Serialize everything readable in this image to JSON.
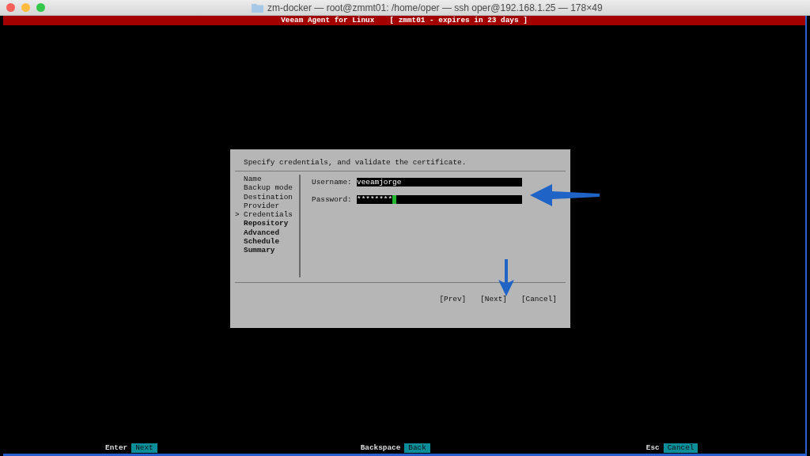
{
  "window": {
    "title": "zm-docker — root@zmmt01: /home/oper — ssh oper@192.168.1.25 — 178×49"
  },
  "header": {
    "app": "Veeam Agent for Linux",
    "info": "[ zmmt01 - expires in 23 days ]"
  },
  "dialog": {
    "prompt": "Specify credentials, and validate the certificate.",
    "steps": [
      {
        "label": "Name",
        "selected": false,
        "pending": false
      },
      {
        "label": "Backup mode",
        "selected": false,
        "pending": false
      },
      {
        "label": "Destination",
        "selected": false,
        "pending": false
      },
      {
        "label": "Provider",
        "selected": false,
        "pending": false
      },
      {
        "label": "Credentials",
        "selected": true,
        "pending": false
      },
      {
        "label": "Repository",
        "selected": false,
        "pending": true
      },
      {
        "label": "Advanced",
        "selected": false,
        "pending": true
      },
      {
        "label": "Schedule",
        "selected": false,
        "pending": true
      },
      {
        "label": "Summary",
        "selected": false,
        "pending": true
      }
    ],
    "marker": ">",
    "fields": [
      {
        "label": "Username:",
        "value": "veeamjorge",
        "focused": false
      },
      {
        "label": "Password:",
        "value": "********",
        "focused": true
      }
    ],
    "buttons": [
      "[Prev]",
      "[Next]",
      "[Cancel]"
    ]
  },
  "hotkeys": [
    {
      "key": "Enter",
      "action": "Next"
    },
    {
      "key": "Backspace",
      "action": "Back"
    },
    {
      "key": "Esc",
      "action": "Cancel"
    }
  ]
}
